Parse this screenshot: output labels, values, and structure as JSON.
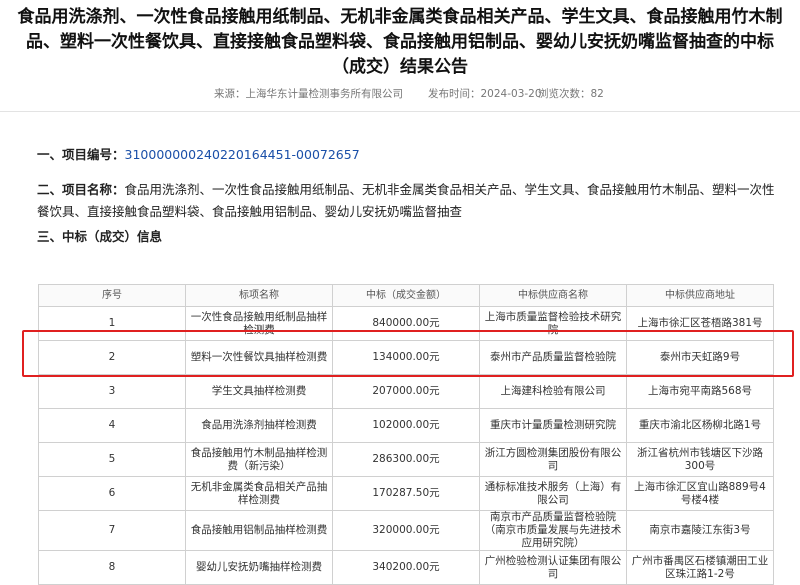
{
  "article": {
    "title": "食品用洗涤剂、一次性食品接触用纸制品、无机非金属类食品相关产品、学生文具、食品接触用竹木制品、塑料一次性餐饮具、直接接触食品塑料袋、食品接触用铝制品、婴幼儿安抚奶嘴监督抽查的中标（成交）结果公告",
    "source": "来源：上海华东计量检测事务所有限公司",
    "publish_time": "发布时间：2024-03-20",
    "views": "浏览次数：82"
  },
  "sections": {
    "project_no_label": "一、项目编号：",
    "project_no_value": "310000000240220164451-00072657",
    "project_name_label": "二、项目名称：",
    "project_name_value": "食品用洗涤剂、一次性食品接触用纸制品、无机非金属类食品相关产品、学生文具、食品接触用竹木制品、塑料一次性餐饮具、直接接触食品塑料袋、食品接触用铝制品、婴幼儿安抚奶嘴监督抽查",
    "award_label": "三、中标（成交）信息"
  },
  "table": {
    "headers": [
      "序号",
      "标项名称",
      "中标（成交金额）",
      "中标供应商名称",
      "中标供应商地址"
    ],
    "rows": [
      [
        "1",
        "一次性食品接触用纸制品抽样检测费",
        "840000.00元",
        "上海市质量监督检验技术研究院",
        "上海市徐汇区苍梧路381号"
      ],
      [
        "2",
        "塑料一次性餐饮具抽样检测费",
        "134000.00元",
        "泰州市产品质量监督检验院",
        "泰州市天虹路9号"
      ],
      [
        "3",
        "学生文具抽样检测费",
        "207000.00元",
        "上海建科检验有限公司",
        "上海市宛平南路568号"
      ],
      [
        "4",
        "食品用洗涤剂抽样检测费",
        "102000.00元",
        "重庆市计量质量检测研究院",
        "重庆市渝北区杨柳北路1号"
      ],
      [
        "5",
        "食品接触用竹木制品抽样检测费（新污染）",
        "286300.00元",
        "浙江方圆检测集团股份有限公司",
        "浙江省杭州市钱塘区下沙路300号"
      ],
      [
        "6",
        "无机非金属类食品相关产品抽样检测费",
        "170287.50元",
        "通标标准技术服务（上海）有限公司",
        "上海市徐汇区宜山路889号4号楼4楼"
      ],
      [
        "7",
        "食品接触用铝制品抽样检测费",
        "320000.00元",
        "南京市产品质量监督检验院（南京市质量发展与先进技术应用研究院）",
        "南京市嘉陵江东街3号"
      ],
      [
        "8",
        "婴幼儿安抚奶嘴抽样检测费",
        "340200.00元",
        "广州检验检测认证集团有限公司",
        "广州市番禺区石楼镇潮田工业区珠江路1-2号"
      ]
    ]
  },
  "colors": {
    "highlight": "#e02020",
    "link_blue": "#1a4fa8"
  }
}
